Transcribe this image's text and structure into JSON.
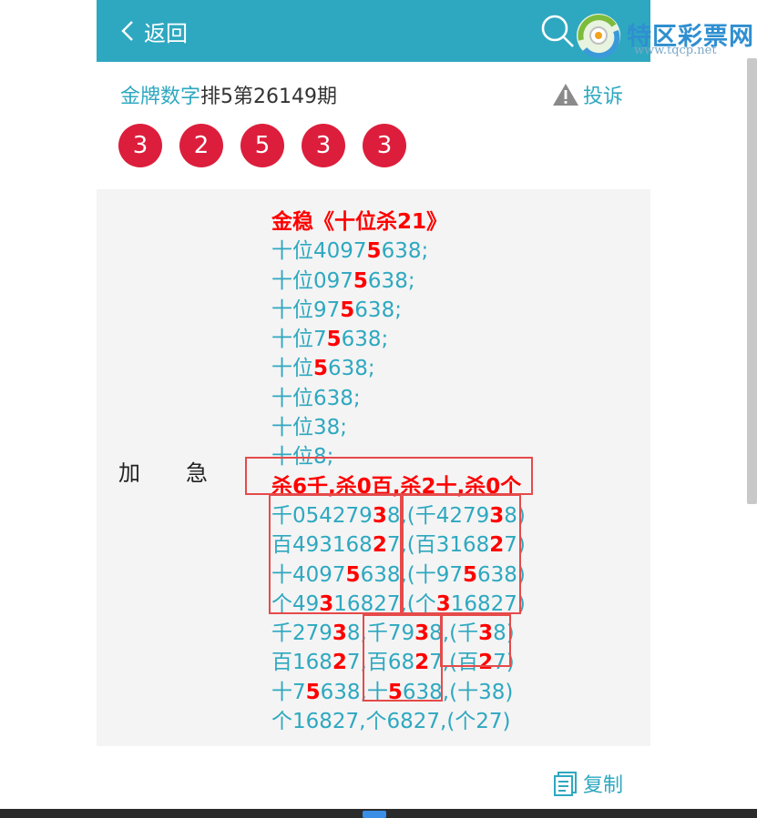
{
  "header": {
    "back_label": "返回",
    "bg_color": "#2ea8c0"
  },
  "logo": {
    "name": "特区彩票网",
    "url": "www.tqcp.net"
  },
  "issue": {
    "link_text": "金牌数字",
    "title": "排5第26149期"
  },
  "report_label": "投诉",
  "balls": [
    "3",
    "2",
    "5",
    "3",
    "3"
  ],
  "ball_color": "#dc1e3c",
  "side_label": "加急",
  "tip_lines": [
    [
      {
        "t": "金稳《十位杀21》",
        "c": "red"
      }
    ],
    [
      {
        "t": "十位4097"
      },
      {
        "t": "5",
        "c": "hl"
      },
      {
        "t": "638;"
      }
    ],
    [
      {
        "t": "十位097"
      },
      {
        "t": "5",
        "c": "hl"
      },
      {
        "t": "638;"
      }
    ],
    [
      {
        "t": "十位97"
      },
      {
        "t": "5",
        "c": "hl"
      },
      {
        "t": "638;"
      }
    ],
    [
      {
        "t": "十位7"
      },
      {
        "t": "5",
        "c": "hl"
      },
      {
        "t": "638;"
      }
    ],
    [
      {
        "t": "十位"
      },
      {
        "t": "5",
        "c": "hl"
      },
      {
        "t": "638;"
      }
    ],
    [
      {
        "t": "十位638;"
      }
    ],
    [
      {
        "t": "十位38;"
      }
    ],
    [
      {
        "t": "十位8;"
      }
    ],
    [
      {
        "t": "杀6千,杀0百,杀2十,杀0个",
        "c": "red"
      }
    ],
    [
      {
        "t": "千054279"
      },
      {
        "t": "3",
        "c": "hl"
      },
      {
        "t": "8,(千4279"
      },
      {
        "t": "3",
        "c": "hl"
      },
      {
        "t": "8)"
      }
    ],
    [
      {
        "t": "百493168"
      },
      {
        "t": "2",
        "c": "hl"
      },
      {
        "t": "7,(百3168"
      },
      {
        "t": "2",
        "c": "hl"
      },
      {
        "t": "7)"
      }
    ],
    [
      {
        "t": "十4097"
      },
      {
        "t": "5",
        "c": "hl"
      },
      {
        "t": "638,(十97"
      },
      {
        "t": "5",
        "c": "hl"
      },
      {
        "t": "638)"
      }
    ],
    [
      {
        "t": "个49"
      },
      {
        "t": "3",
        "c": "hl"
      },
      {
        "t": "16827,(个"
      },
      {
        "t": "3",
        "c": "hl"
      },
      {
        "t": "16827)"
      }
    ],
    [
      {
        "t": "千279"
      },
      {
        "t": "3",
        "c": "hl"
      },
      {
        "t": "8,千79"
      },
      {
        "t": "3",
        "c": "hl"
      },
      {
        "t": "8,(千"
      },
      {
        "t": "3",
        "c": "hl"
      },
      {
        "t": "8)"
      }
    ],
    [
      {
        "t": "百168"
      },
      {
        "t": "2",
        "c": "hl"
      },
      {
        "t": "7,百68"
      },
      {
        "t": "2",
        "c": "hl"
      },
      {
        "t": "7,(百"
      },
      {
        "t": "2",
        "c": "hl"
      },
      {
        "t": "7)"
      }
    ],
    [
      {
        "t": "十7"
      },
      {
        "t": "5",
        "c": "hl"
      },
      {
        "t": "638,十"
      },
      {
        "t": "5",
        "c": "hl"
      },
      {
        "t": "638,(十38)"
      }
    ],
    [
      {
        "t": "个16827,个6827,(个27)"
      }
    ]
  ],
  "copy_label": "复制"
}
